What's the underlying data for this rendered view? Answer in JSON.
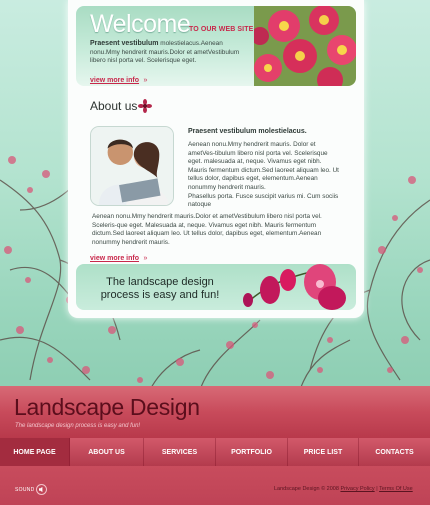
{
  "welcome": {
    "title": "Welcome",
    "subtitle": "TO OUR WEB SITE",
    "bold": "Praesent vestibulum",
    "text": " molestielacus.Aenean nonu.Mmy hendrerit mauris.Dolor et ametVestibulum libero nisl porta vel. Scelerisque eget.",
    "more": "view more info"
  },
  "about": {
    "heading": "About us",
    "bold": "Praesent vestibulum molestielacus.",
    "text1": "Aenean nonu.Mmy hendrerit mauris. Dolor et ametVes-tibulum libero nisl porta vel. Scelerisque eget. malesuada at, neque. Vivamus eget nibh. Mauris fermentum dictum.Sed laoreet aliquam leo. Ut tellus dolor, dapibus eget, elementum.Aenean nonummy hendrerit mauris.",
    "text2": "Phasellus porta. Fusce suscipit varius mi. Cum sociis natoque",
    "text3": "Aenean nonu.Mmy hendrerit mauris.Dolor et ametVestibulum libero nisl porta vel. Sceleris-que eget. Malesuada at, neque. Vivamus eget nibh. Mauris fermentum dictum.Sed laoreet aliquam leo. Ut tellus dolor, dapibus eget, elementum.Aenean nonummy hendrerit mauris.",
    "more": "view more info"
  },
  "process": {
    "line1": "The landscape design",
    "line2": "process is easy and fun!"
  },
  "header": {
    "brand": "Landscape Design",
    "slogan": "The landscape design process is easy and fun!"
  },
  "nav": [
    {
      "label": "HOME PAGE",
      "active": true
    },
    {
      "label": "ABOUT US"
    },
    {
      "label": "SERVICES"
    },
    {
      "label": "PORTFOLIO"
    },
    {
      "label": "PRICE LIST"
    },
    {
      "label": "CONTACTS"
    }
  ],
  "footer": {
    "sound": "SOUND",
    "copyright": "Landscape Design © 2008",
    "privacy": "Privacy Policy",
    "separator": "|",
    "terms": "Terms Of Use"
  },
  "colors": {
    "accent": "#c8284b",
    "header": "#c84b5b",
    "background": "#a8dcc7"
  },
  "icons": [
    "flower-icon",
    "sound-icon",
    "arrow-icon"
  ]
}
